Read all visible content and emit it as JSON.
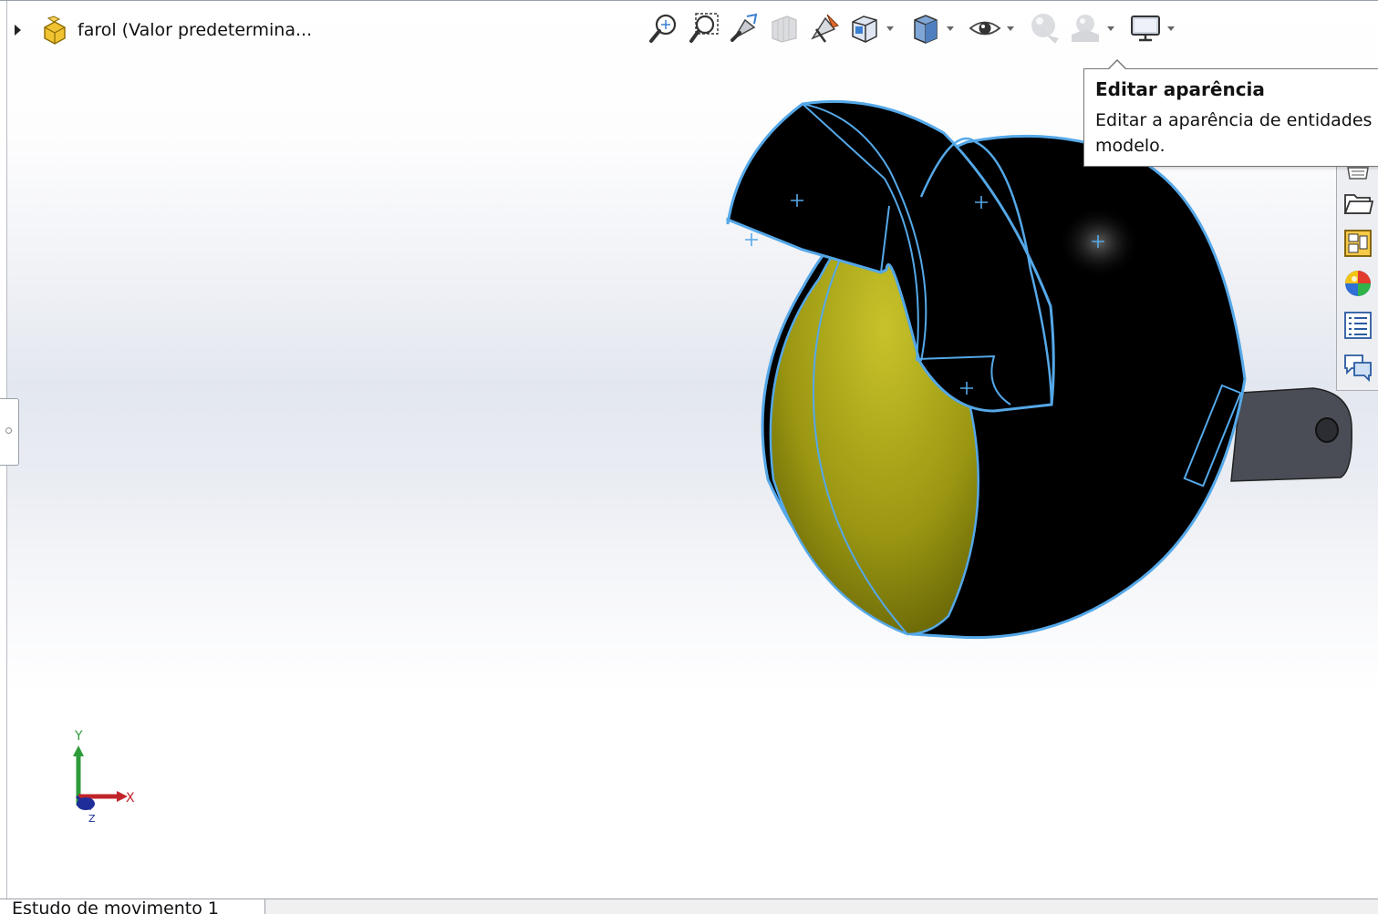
{
  "feature_tree": {
    "part_label": "farol  (Valor predetermina..."
  },
  "heads_up_toolbar": {
    "buttons": [
      {
        "name": "zoom-to-fit",
        "icon": "zoom-to-fit-icon"
      },
      {
        "name": "zoom-to-area",
        "icon": "zoom-to-area-icon"
      },
      {
        "name": "previous-view",
        "icon": "previous-view-icon"
      },
      {
        "name": "section-view",
        "icon": "section-view-icon"
      },
      {
        "name": "dynamic-annotation-views",
        "icon": "dynamic-annotation-icon"
      },
      {
        "name": "view-orientation",
        "icon": "view-orientation-icon"
      },
      {
        "name": "display-style",
        "icon": "display-style-icon"
      },
      {
        "name": "hide-show-items",
        "icon": "eye-icon"
      },
      {
        "name": "edit-appearance",
        "icon": "appearance-sphere-icon"
      },
      {
        "name": "apply-scene",
        "icon": "scene-icon"
      },
      {
        "name": "view-settings",
        "icon": "monitor-icon"
      }
    ]
  },
  "tooltip": {
    "title": "Editar aparência",
    "text_line1": "Editar a aparência de entidades",
    "text_line2": "modelo."
  },
  "task_pane": {
    "icons": [
      "resources-icon",
      "design-library-icon",
      "file-explorer-icon",
      "view-palette-icon",
      "appearances-icon",
      "custom-properties-icon",
      "forum-icon"
    ]
  },
  "model": {
    "name": "farol",
    "colors": {
      "body": "#000000",
      "lens": "#b9b51a",
      "selection_edge": "#55a8e8",
      "bracket": "#4a4d55"
    }
  },
  "triad": {
    "x_label": "X",
    "y_label": "Y",
    "z_label": "Z"
  },
  "status_bar": {
    "tab_label": "Estudo de movimento 1"
  }
}
